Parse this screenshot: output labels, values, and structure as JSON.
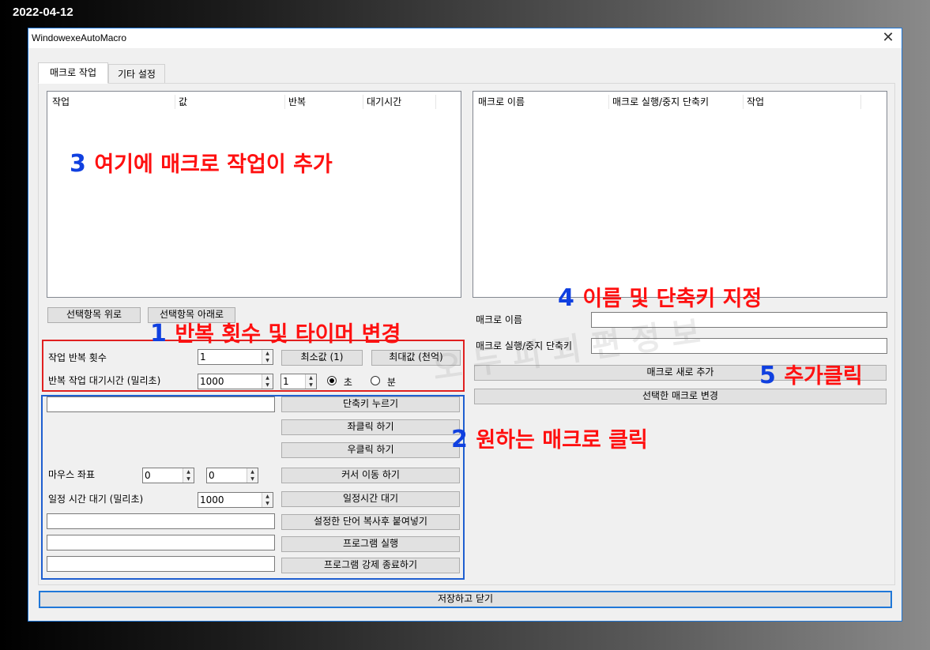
{
  "date": "2022-04-12",
  "window": {
    "title": "WindowexeAutoMacro"
  },
  "tabs": [
    "매크로 작업",
    "기타 설정"
  ],
  "task_list": {
    "columns": [
      "작업",
      "값",
      "반복",
      "대기시간"
    ]
  },
  "macro_list": {
    "columns": [
      "매크로 이름",
      "매크로 실행/중지 단축키",
      "작업"
    ]
  },
  "buttons": {
    "move_up": "선택항목 위로",
    "move_down": "선택항목 아래로",
    "min_value": "최소값 (1)",
    "max_value": "최대값 (천억)",
    "press_shortcut": "단축키 누르기",
    "left_click": "좌클릭 하기",
    "right_click": "우클릭 하기",
    "move_cursor": "커서 이동 하기",
    "wait_time": "일정시간 대기",
    "paste_text": "설정한 단어 복사후 붙여넣기",
    "run_program": "프로그램 실행",
    "kill_program": "프로그램 강제 종료하기",
    "add_macro": "매크로 새로 추가",
    "change_macro": "선택한 매크로 변경",
    "save_close": "저장하고 닫기"
  },
  "labels": {
    "repeat_count": "작업 반복 횟수",
    "repeat_wait": "반복 작업 대기시간 (밀리초)",
    "sec": "초",
    "min": "분",
    "mouse_coords": "마우스 좌표",
    "wait_ms": "일정 시간 대기 (밀리초)",
    "macro_name": "매크로 이름",
    "macro_hotkey": "매크로 실행/중지 단축키"
  },
  "values": {
    "repeat_count": "1",
    "repeat_wait": "1000",
    "repeat_wait_unit": "1",
    "mouse_x": "0",
    "mouse_y": "0",
    "wait_ms": "1000"
  },
  "annotations": {
    "a1_num": "1",
    "a1_text": "반복 횟수 및 타이머 변경",
    "a2_num": "2",
    "a2_text": "원하는 매크로 클릭",
    "a3_num": "3",
    "a3_text": "여기에 매크로 작업이 추가",
    "a4_num": "4",
    "a4_text": "이름 및 단축키 지정",
    "a5_num": "5",
    "a5_text": "추가클릭"
  },
  "watermark": "오 두 피 괴 편 정 보",
  "colors": {
    "annotation_red": "#ff1010",
    "annotation_blue": "#1040e0",
    "box_red": "#e02020",
    "box_blue": "#1f5fd0",
    "accent": "#1f77d8"
  }
}
